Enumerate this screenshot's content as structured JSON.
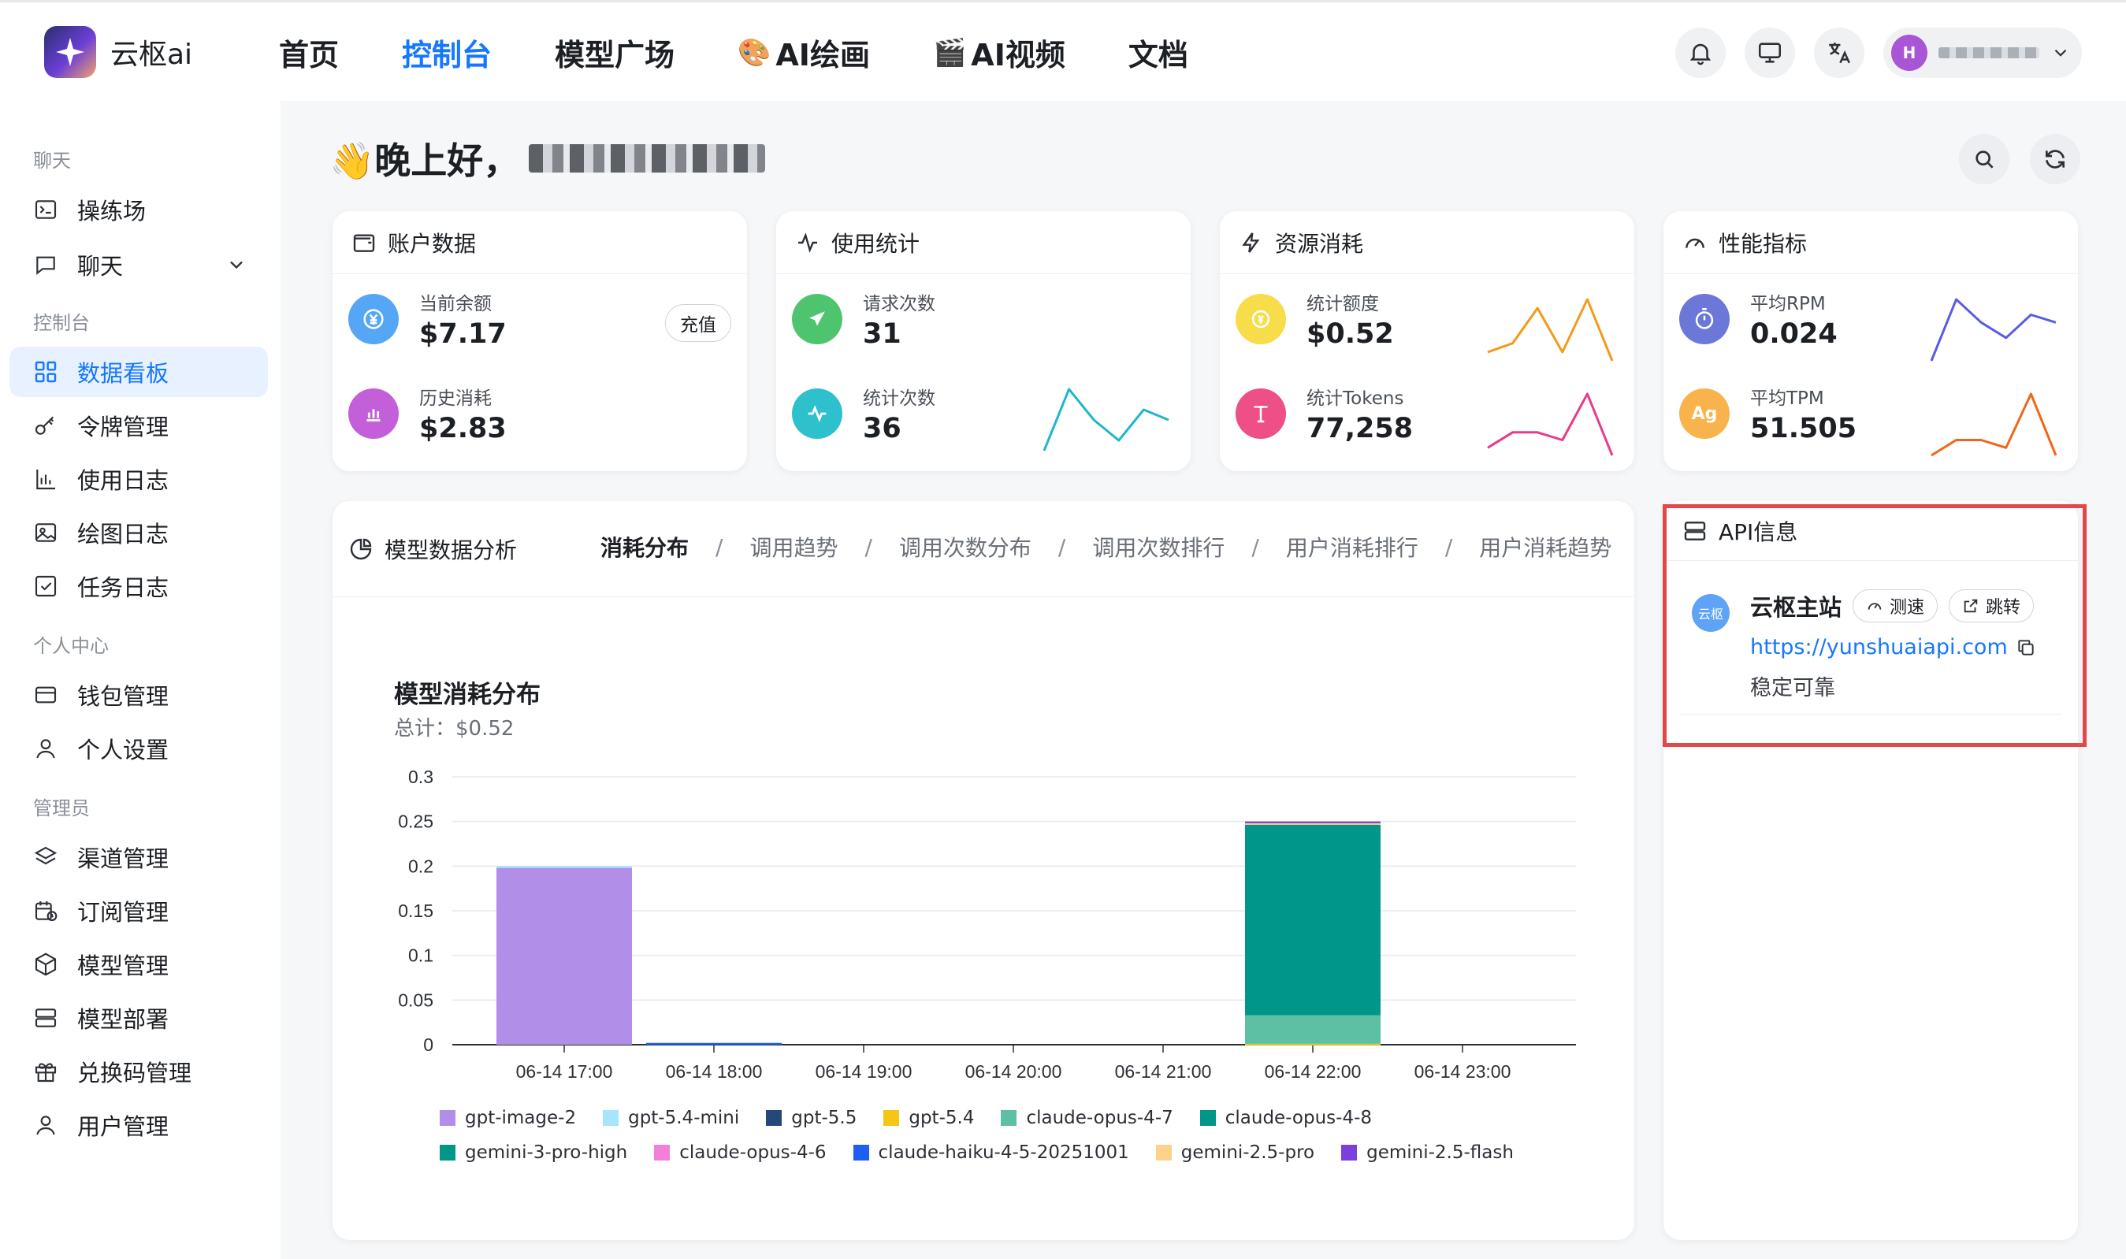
{
  "brand": {
    "name": "云枢ai"
  },
  "nav": {
    "items": [
      {
        "label": "首页",
        "emoji": ""
      },
      {
        "label": "控制台",
        "emoji": ""
      },
      {
        "label": "模型广场",
        "emoji": ""
      },
      {
        "label": "AI绘画",
        "emoji": "🎨"
      },
      {
        "label": "AI视频",
        "emoji": "🎬"
      },
      {
        "label": "文档",
        "emoji": ""
      }
    ],
    "active": "控制台"
  },
  "user": {
    "avatar_letter": "H"
  },
  "sidebar": {
    "sections": [
      {
        "title": "聊天",
        "items": [
          "操练场",
          "聊天"
        ]
      },
      {
        "title": "控制台",
        "items": [
          "数据看板",
          "令牌管理",
          "使用日志",
          "绘图日志",
          "任务日志"
        ]
      },
      {
        "title": "个人中心",
        "items": [
          "钱包管理",
          "个人设置"
        ]
      },
      {
        "title": "管理员",
        "items": [
          "渠道管理",
          "订阅管理",
          "模型管理",
          "模型部署",
          "兑换码管理",
          "用户管理"
        ]
      }
    ],
    "active": "数据看板"
  },
  "greeting": {
    "text": "👋晚上好，"
  },
  "cards": {
    "account": {
      "title": "账户数据",
      "balance_label": "当前余额",
      "balance_value": "$7.17",
      "recharge_label": "充值",
      "history_label": "历史消耗",
      "history_value": "$2.83"
    },
    "usage": {
      "title": "使用统计",
      "requests_label": "请求次数",
      "requests_value": "31",
      "stat_label": "统计次数",
      "stat_value": "36"
    },
    "resource": {
      "title": "资源消耗",
      "quota_label": "统计额度",
      "quota_value": "$0.52",
      "tokens_label": "统计Tokens",
      "tokens_value": "77,258"
    },
    "performance": {
      "title": "性能指标",
      "rpm_label": "平均RPM",
      "rpm_value": "0.024",
      "tpm_label": "平均TPM",
      "tpm_value": "51.505"
    }
  },
  "analysis": {
    "title": "模型数据分析",
    "tabs": [
      "消耗分布",
      "调用趋势",
      "调用次数分布",
      "调用次数排行",
      "用户消耗排行",
      "用户消耗趋势"
    ],
    "active_tab": "消耗分布"
  },
  "chart_data": {
    "type": "bar",
    "stacked": true,
    "title": "模型消耗分布",
    "subtitle": "总计：$0.52",
    "categories": [
      "06-14 17:00",
      "06-14 18:00",
      "06-14 19:00",
      "06-14 20:00",
      "06-14 21:00",
      "06-14 22:00",
      "06-14 23:00"
    ],
    "ylim": [
      0,
      0.3
    ],
    "yticks": [
      "0",
      "0.05",
      "0.1",
      "0.15",
      "0.2",
      "0.25",
      "0.3"
    ],
    "grid": true,
    "legend_position": "bottom",
    "series": [
      {
        "name": "gpt-image-2",
        "color": "#b18ee8",
        "values": [
          0.198,
          0,
          0,
          0,
          0,
          0,
          0
        ]
      },
      {
        "name": "gpt-5.4-mini",
        "color": "#a5e6fb",
        "values": [
          0.002,
          0,
          0,
          0,
          0,
          0,
          0
        ]
      },
      {
        "name": "gpt-5.5",
        "color": "#24487a",
        "values": [
          0,
          0.001,
          0,
          0,
          0,
          0,
          0
        ]
      },
      {
        "name": "gpt-5.4",
        "color": "#f5c518",
        "values": [
          0,
          0,
          0,
          0,
          0,
          0.001,
          0
        ]
      },
      {
        "name": "claude-opus-4-7",
        "color": "#5dbfa3",
        "values": [
          0,
          0,
          0,
          0,
          0,
          0.032,
          0
        ]
      },
      {
        "name": "claude-opus-4-8",
        "color": "#00968a",
        "values": [
          0,
          0,
          0,
          0,
          0,
          0.214,
          0
        ]
      },
      {
        "name": "gemini-3-pro-high",
        "color": "#00968a",
        "values": [
          0,
          0,
          0,
          0,
          0,
          0,
          0
        ]
      },
      {
        "name": "claude-opus-4-6",
        "color": "#f47fd9",
        "values": [
          0,
          0,
          0,
          0,
          0,
          0,
          0
        ]
      },
      {
        "name": "claude-haiku-4-5-20251001",
        "color": "#1f5ef5",
        "values": [
          0,
          0.001,
          0,
          0,
          0,
          0,
          0
        ]
      },
      {
        "name": "gemini-2.5-pro",
        "color": "#fcd38a",
        "values": [
          0,
          0,
          0,
          0,
          0,
          0.001,
          0
        ]
      },
      {
        "name": "gemini-2.5-flash",
        "color": "#7b3fdc",
        "values": [
          0,
          0,
          0,
          0,
          0,
          0.002,
          0
        ]
      }
    ]
  },
  "sparklines": {
    "usage_stat": {
      "color": "#1fb6cf",
      "values": [
        2,
        8,
        5,
        3,
        6,
        5
      ]
    },
    "resource_quota": {
      "color": "#f29a1a",
      "values": [
        1,
        2,
        6,
        1,
        7,
        0
      ]
    },
    "resource_tokens": {
      "color": "#ea3a8a",
      "values": [
        1,
        3,
        3,
        2,
        8,
        0
      ]
    },
    "perf_rpm": {
      "color": "#5a5ae8",
      "values": [
        0,
        8,
        5,
        3,
        6,
        5
      ]
    },
    "perf_tpm": {
      "color": "#f2651a",
      "values": [
        0,
        2,
        2,
        1,
        8,
        0
      ]
    }
  },
  "api": {
    "title": "API信息",
    "site_badge": "云枢",
    "site_name": "云枢主站",
    "speed_test_label": "测速",
    "jump_label": "跳转",
    "url": "https://yunshuaiapi.com",
    "description": "稳定可靠"
  }
}
